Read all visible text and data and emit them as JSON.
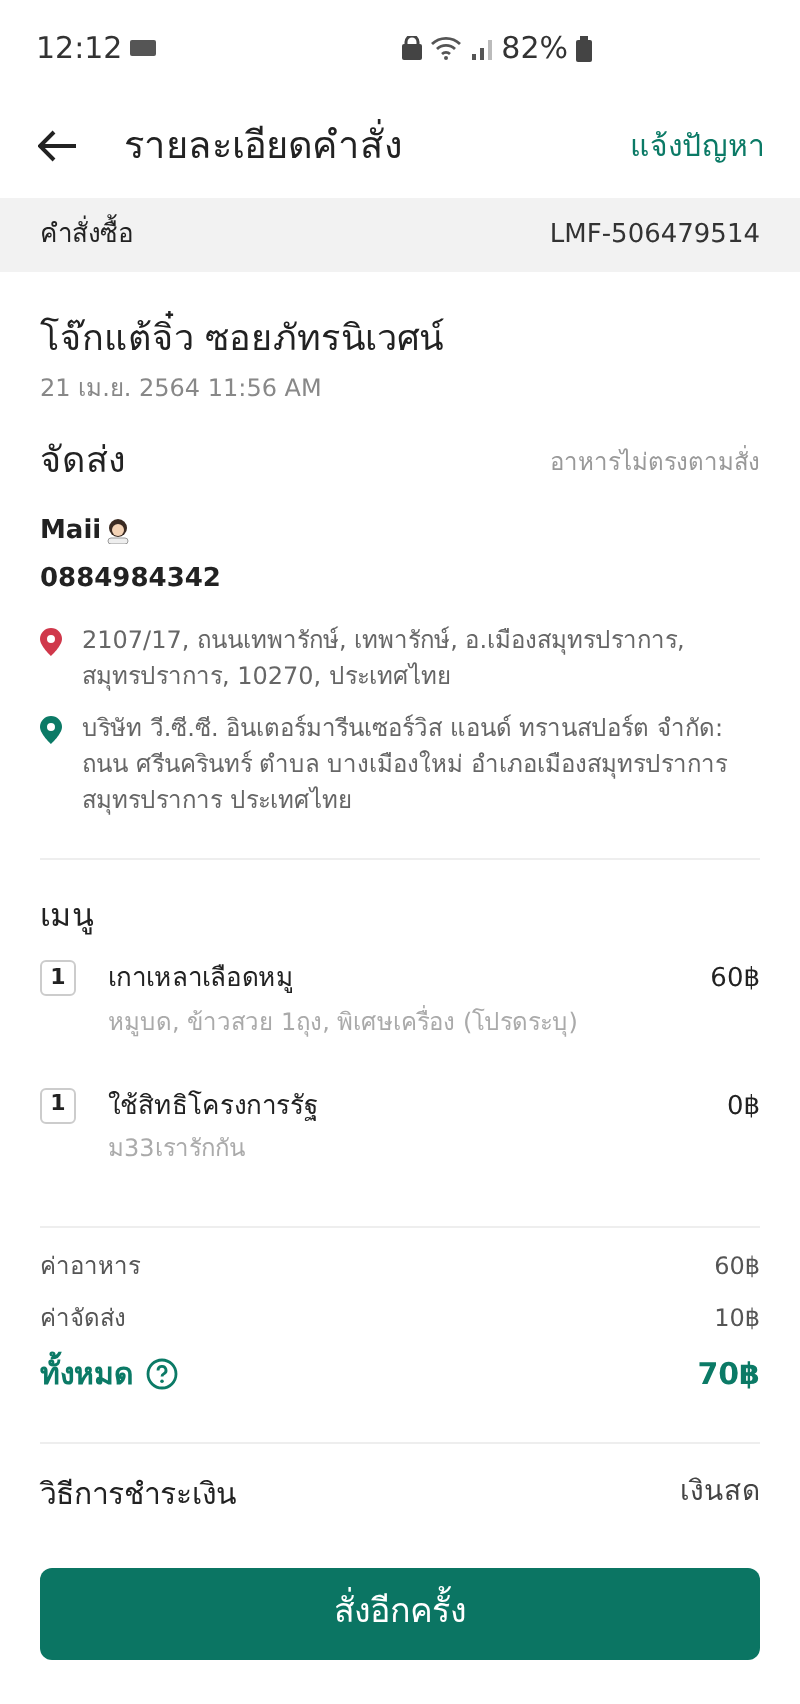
{
  "status_bar": {
    "time": "12:12",
    "battery": "82%"
  },
  "header": {
    "title": "รายละเอียดคำสั่ง",
    "action": "แจ้งปัญหา"
  },
  "order_bar": {
    "label": "คำสั่งซื้อ",
    "number": "LMF-506479514"
  },
  "restaurant": {
    "name": "โจ๊กแต้จิ๋ว ซอยภัทรนิเวศน์",
    "date": "21 เม.ย. 2564 11:56 AM"
  },
  "delivery": {
    "title": "จัดส่ง",
    "link": "อาหารไม่ตรงตามสั่ง",
    "customer": "Maii",
    "phone": "0884984342",
    "addresses": [
      {
        "color": "#d0384b",
        "text": "2107/17, ถนนเทพารักษ์, เทพารักษ์, อ.เมืองสมุทรปราการ, สมุทรปราการ, 10270, ประเทศไทย"
      },
      {
        "color": "#0b7a66",
        "text": "บริษัท วี.ซี.ซี. อินเตอร์มารีนเซอร์วิส แอนด์ ทรานสปอร์ต จำกัด: ถนน ศรีนครินทร์ ตำบล บางเมืองใหม่ อำเภอเมืองสมุทรปราการ สมุทรปราการ ประเทศไทย"
      }
    ]
  },
  "menu": {
    "title": "เมนู",
    "items": [
      {
        "qty": "1",
        "name": "เกาเหลาเลือดหมู",
        "note": "หมูบด, ข้าวสวย 1ถุง, พิเศษเครื่อง (โปรดระบุ)",
        "price": "60฿"
      },
      {
        "qty": "1",
        "name": "ใช้สิทธิโครงการรัฐ",
        "note": "ม33เรารักกัน",
        "price": "0฿"
      }
    ]
  },
  "summary": [
    {
      "kind": "fee",
      "label": "ค่าอาหาร",
      "value": "60฿"
    },
    {
      "kind": "fee",
      "label": "ค่าจัดส่ง",
      "value": "10฿"
    },
    {
      "kind": "total",
      "label": "ทั้งหมด",
      "value": "70฿"
    }
  ],
  "payment": {
    "label": "วิธีการชำระเงิน",
    "value": "เงินสด"
  },
  "button": "สั่งอีกครั้ง"
}
